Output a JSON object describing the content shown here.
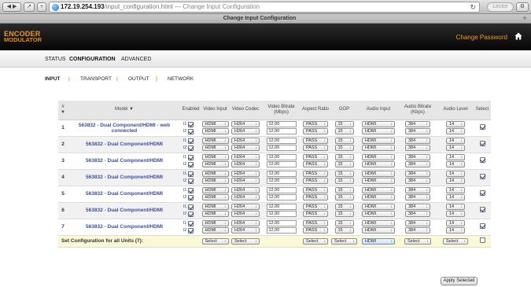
{
  "browser": {
    "url_host": "172.19.254.193",
    "url_path": "/input_configuration.html",
    "url_title": " — Change Input Configuration",
    "tab_title": "Change Input Configuration",
    "reader_label": "Lector"
  },
  "header": {
    "logo_line1": "ENCODER",
    "logo_line2": "MODULATOR",
    "change_password": "Change Password",
    "accent": "#f29a1f"
  },
  "topnav": [
    "STATUS",
    "CONFIGURATION",
    "ADVANCED"
  ],
  "subnav": [
    "INPUT",
    "TRANSPORT",
    "OUTPUT",
    "NETWORK"
  ],
  "table": {
    "headers": {
      "num_top": "#",
      "num_arrow": "▼",
      "model": "Model ▼",
      "enabled": "Enabled",
      "video_input": "Video Input",
      "video_codec": "Video Codec",
      "video_bitrate": "Video Bitrate (Mbps)",
      "aspect_ratio": "Aspect Ratio",
      "gop": "GOP",
      "audio_input": "Audio Input",
      "audio_bitrate": "Audio Bitrate (Kbps)",
      "audio_level": "Audio Level",
      "select": "Select"
    },
    "rows": [
      {
        "num": "1",
        "model": "563832 - Dual Component/HDMI - web connected",
        "i1": "I1",
        "i2": "I2",
        "video_input": "HDMI",
        "video_codec": "H264",
        "bitrate": "12,00",
        "aspect": "PASS",
        "gop": "15",
        "audio_input": "HDMI",
        "audio_bitrate": "384",
        "audio_level": "14"
      },
      {
        "num": "2",
        "model": "563832 - Dual Component/HDMI",
        "i1": "I1",
        "i2": "I2",
        "video_input": "HDMI",
        "video_codec": "H264",
        "bitrate": "12,00",
        "aspect": "PASS",
        "gop": "15",
        "audio_input": "HDMI",
        "audio_bitrate": "384",
        "audio_level": "14"
      },
      {
        "num": "3",
        "model": "563832 - Dual Component/HDMI",
        "i1": "I1",
        "i2": "I2",
        "video_input": "HDMI",
        "video_codec": "H264",
        "bitrate": "12,00",
        "aspect": "PASS",
        "gop": "15",
        "audio_input": "HDMI",
        "audio_bitrate": "384",
        "audio_level": "14"
      },
      {
        "num": "4",
        "model": "563832 - Dual Component/HDMI",
        "i1": "I1",
        "i2": "I2",
        "video_input": "HDMI",
        "video_codec": "H264",
        "bitrate": "12,00",
        "aspect": "PASS",
        "gop": "15",
        "audio_input": "HDMI",
        "audio_bitrate": "384",
        "audio_level": "14"
      },
      {
        "num": "5",
        "model": "563832 - Dual Component/HDMI",
        "i1": "I1",
        "i2": "I2",
        "video_input": "HDMI",
        "video_codec": "H264",
        "bitrate": "12,00",
        "aspect": "PASS",
        "gop": "15",
        "audio_input": "HDMI",
        "audio_bitrate": "384",
        "audio_level": "14"
      },
      {
        "num": "6",
        "model": "563832 - Dual Component/HDMI",
        "i1": "I1",
        "i2": "I2",
        "video_input": "HDMI",
        "video_codec": "H264",
        "bitrate": "12,00",
        "aspect": "PASS",
        "gop": "15",
        "audio_input": "HDMI",
        "audio_bitrate": "384",
        "audio_level": "14"
      },
      {
        "num": "7",
        "model": "563832 - Dual Component/HDMI",
        "i1": "I1",
        "i2": "I2",
        "video_input": "HDMI",
        "video_codec": "H264",
        "bitrate": "12,00",
        "aspect": "PASS",
        "gop": "15",
        "audio_input": "HDMI",
        "audio_bitrate": "384",
        "audio_level": "14"
      }
    ],
    "footer": {
      "label": "Set Configuration for all Units (7):",
      "video_input": "Select",
      "video_codec": "Select",
      "aspect": "Select",
      "gop": "Select",
      "audio_input": "HDMI",
      "audio_bitrate": "Select",
      "audio_level": "Select"
    }
  },
  "apply_button": "Apply Selected"
}
